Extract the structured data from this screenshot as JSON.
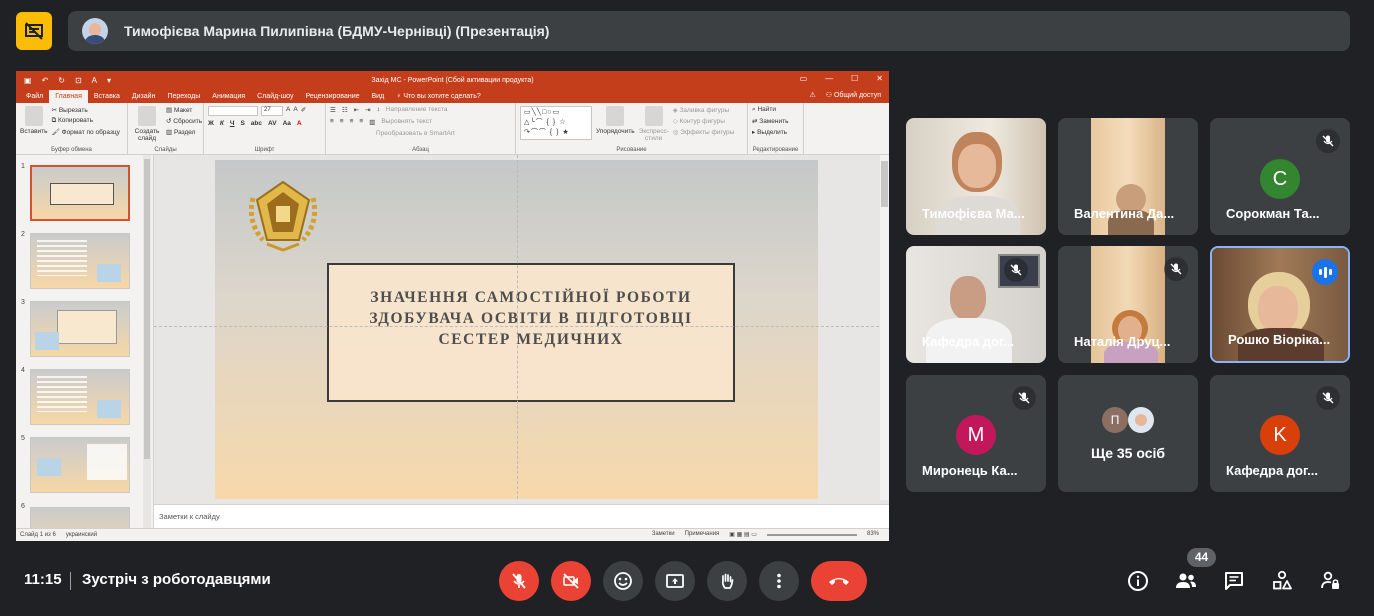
{
  "presenter": {
    "name": "Тимофієва Марина Пилипівна (БДМУ-Чернівці) (Презентація)"
  },
  "powerpoint": {
    "window_title": "Захід МС - PowerPoint (Сбой активации продукта)",
    "tabs": [
      "Файл",
      "Главная",
      "Вставка",
      "Дизайн",
      "Переходы",
      "Анимация",
      "Слайд-шоу",
      "Рецензирование",
      "Вид"
    ],
    "active_tab": "Главная",
    "tell_me": "Что вы хотите сделать?",
    "share": "Общий доступ",
    "ribbon": {
      "clipboard": {
        "paste": "Вставить",
        "cut": "Вырезать",
        "copy": "Копировать",
        "format_painter": "Формат по образцу",
        "group": "Буфер обмена"
      },
      "slides": {
        "new_slide": "Создать слайд",
        "layout": "Макет",
        "reset": "Сбросить",
        "section": "Раздел",
        "group": "Слайды"
      },
      "font": {
        "size": "27",
        "group": "Шрифт"
      },
      "paragraph": {
        "direction": "Направление текста",
        "align": "Выровнять текст",
        "smartart": "Преобразовать в SmartArt",
        "group": "Абзац"
      },
      "drawing": {
        "arrange": "Упорядочить",
        "quick_styles": "Экспресс-стили",
        "fill": "Заливка фигуры",
        "outline": "Контур фигуры",
        "effects": "Эффекты фигуры",
        "group": "Рисование"
      },
      "editing": {
        "find": "Найти",
        "replace": "Заменить",
        "select": "Выделить",
        "group": "Редактирование"
      }
    },
    "thumbnails": [
      "1",
      "2",
      "3",
      "4",
      "5",
      "6"
    ],
    "slide": {
      "title": "ЗНАЧЕННЯ САМОСТІЙНОЇ РОБОТИ ЗДОБУВАЧА ОСВІТИ В ПІДГОТОВЦІ СЕСТЕР МЕДИЧНИХ"
    },
    "notes_placeholder": "Заметки к слайду",
    "status": {
      "slide_info": "Слайд 1 из 6",
      "language": "украинский",
      "notes": "Заметки",
      "comments": "Примечания",
      "zoom": "83%"
    }
  },
  "participants": [
    {
      "name": "Тимофієва Ма...",
      "type": "video",
      "muted": false
    },
    {
      "name": "Валентина Да...",
      "type": "video",
      "muted": false
    },
    {
      "name": "Сорокман Та...",
      "type": "avatar",
      "initial": "C",
      "color": "#33862f",
      "muted": true
    },
    {
      "name": "Кафедра дог...",
      "type": "video",
      "muted": true
    },
    {
      "name": "Наталія Друц...",
      "type": "video",
      "muted": true
    },
    {
      "name": "Рошко Віоріка...",
      "type": "video",
      "speaking": true
    },
    {
      "name": "Миронець Ка...",
      "type": "avatar",
      "initial": "M",
      "color": "#c2185b",
      "muted": true
    },
    {
      "name": "Кафедра дог...",
      "type": "avatar",
      "initial": "K",
      "color": "#d93f0b",
      "muted": true
    }
  ],
  "others": {
    "label": "Ще 35 осіб",
    "initial": "П"
  },
  "meeting": {
    "time": "11:15",
    "name": "Зустріч з роботодавцями",
    "people_count": "44"
  },
  "colors": {
    "danger": "#ea4335",
    "tile": "#3c4043",
    "background": "#202124",
    "present_badge": "#fbbc04",
    "accent": "#8ab4f8"
  }
}
